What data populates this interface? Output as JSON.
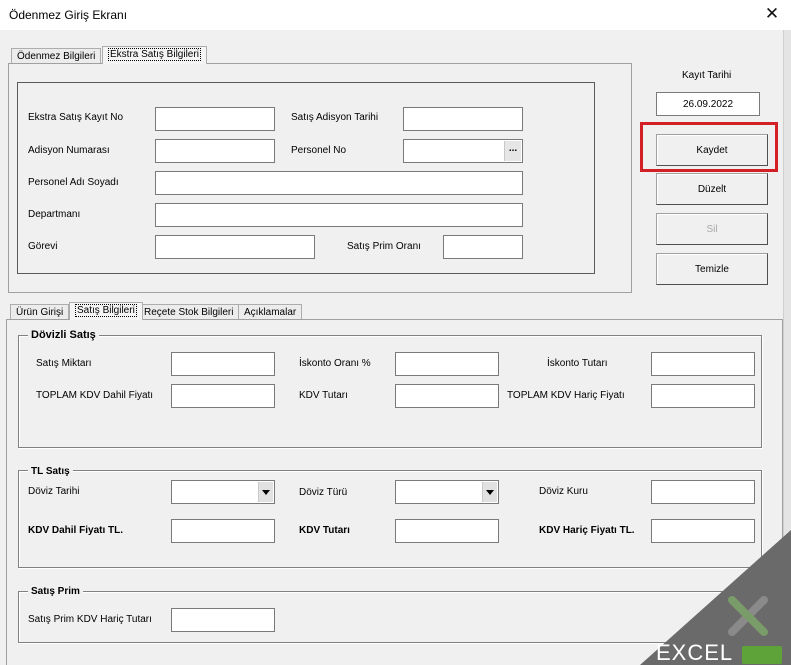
{
  "window": {
    "title": "Ödenmez Giriş Ekranı",
    "close_glyph": "✕"
  },
  "top_tabs": [
    {
      "label": "Ödenmez Bilgileri",
      "active": false
    },
    {
      "label": "Ekstra Satış Bilgileri",
      "active": true
    }
  ],
  "ekstra": {
    "kayit_no_label": "Ekstra Satış Kayıt No",
    "adisyon_tarihi_label": "Satış Adisyon Tarihi",
    "adisyon_no_label": "Adisyon Numarası",
    "personel_no_label": "Personel No",
    "personel_no_button": "...",
    "personel_adi_label": "Personel Adı Soyadı",
    "departman_label": "Departmanı",
    "gorevi_label": "Görevi",
    "prim_orani_label": "Satış Prim Oranı",
    "values": {
      "kayit_no": "",
      "adisyon_tarihi": "",
      "adisyon_no": "",
      "personel_no": "",
      "personel_adi": "",
      "departman": "",
      "gorevi": "",
      "prim_orani": ""
    }
  },
  "side": {
    "kayit_tarihi_label": "Kayıt Tarihi",
    "kayit_tarihi_value": "26.09.2022",
    "buttons": [
      {
        "label": "Kaydet",
        "enabled": true
      },
      {
        "label": "Düzelt",
        "enabled": true
      },
      {
        "label": "Sil",
        "enabled": false
      },
      {
        "label": "Temizle",
        "enabled": true
      }
    ],
    "highlight_color": "#d32027"
  },
  "bottom_tabs": [
    {
      "label": "Ürün Girişi",
      "active": false
    },
    {
      "label": "Satış Bilgileri",
      "active": true
    },
    {
      "label": "Reçete Stok Bilgileri",
      "active": false
    },
    {
      "label": "Açıklamalar",
      "active": false
    }
  ],
  "dovizli": {
    "caption": "Dövizli Satış",
    "satis_miktari_label": "Satış Miktarı",
    "iskonto_orani_label": "İskonto Oranı %",
    "iskonto_tutari_label": "İskonto Tutarı",
    "toplam_kdv_dahil_label": "TOPLAM KDV Dahil Fiyatı",
    "kdv_tutari_label": "KDV Tutarı",
    "toplam_kdv_haric_label": "TOPLAM KDV Hariç Fiyatı"
  },
  "tl": {
    "caption": "TL Satış",
    "doviz_tarihi_label": "Döviz Tarihi",
    "doviz_turu_label": "Döviz Türü",
    "doviz_kuru_label": "Döviz Kuru",
    "kdv_dahil_label": "KDV Dahil Fiyatı TL.",
    "kdv_tutari_label": "KDV Tutarı",
    "kdv_haric_label": "KDV Hariç Fiyatı TL."
  },
  "prim": {
    "caption": "Satış Prim",
    "kdv_haric_tutari_label": "Satış Prim KDV Hariç Tutarı"
  },
  "watermark": {
    "text": "EXCEL"
  }
}
